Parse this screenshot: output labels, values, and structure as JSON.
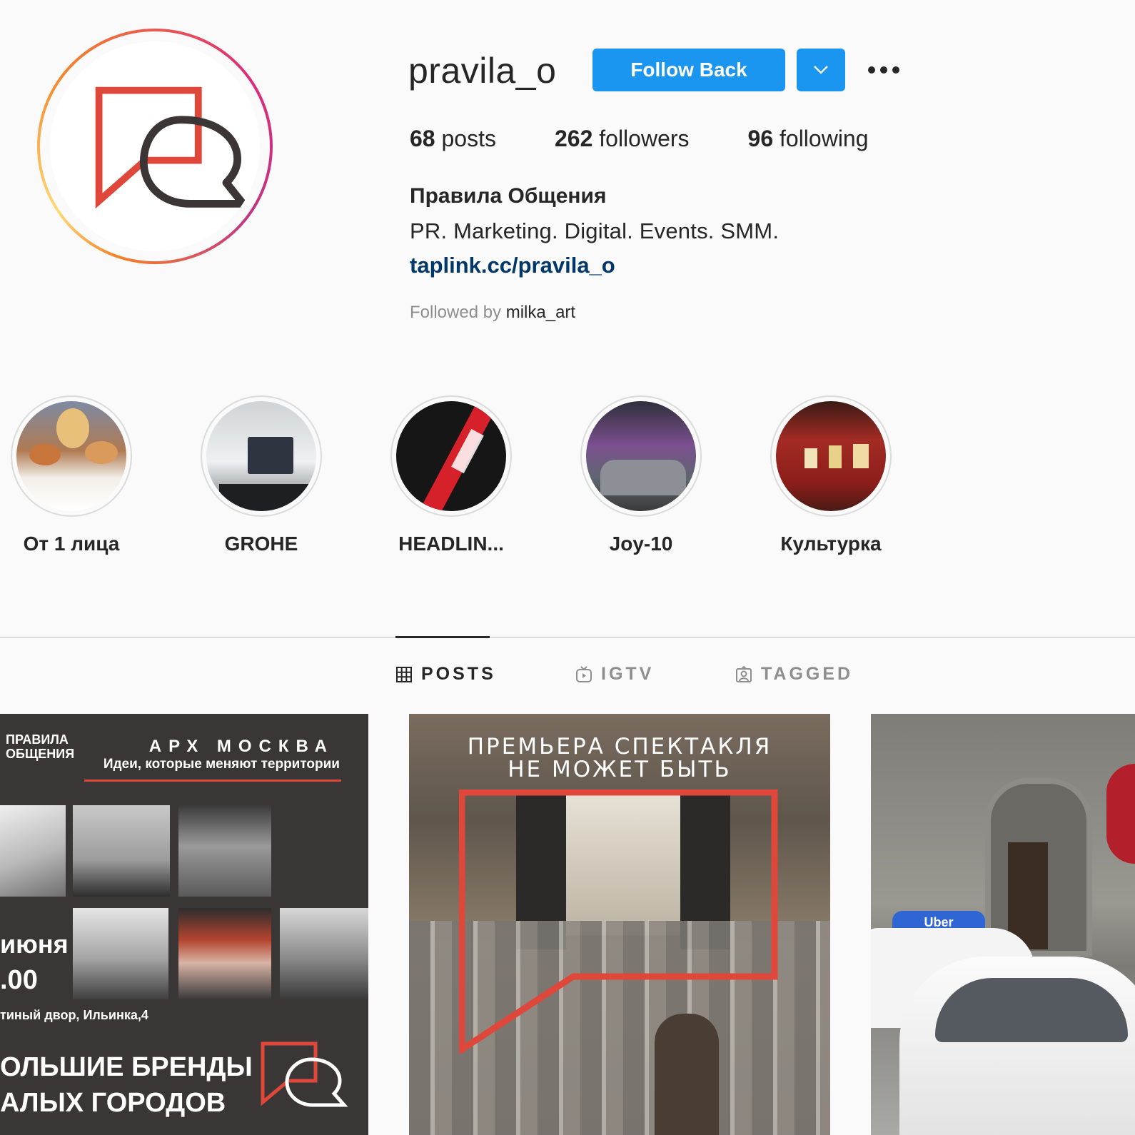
{
  "profile": {
    "username": "pravila_o",
    "follow_label": "Follow Back",
    "stats": {
      "posts_count": "68",
      "posts_label": "posts",
      "followers_count": "262",
      "followers_label": "followers",
      "following_count": "96",
      "following_label": "following"
    },
    "full_name": "Правила Общения",
    "bio": "PR. Marketing. Digital. Events. SMM.",
    "link": "taplink.cc/pravila_o",
    "followed_by_prefix": "Followed by",
    "followed_by_user": "milka_art"
  },
  "highlights": [
    {
      "label": "От 1 лица"
    },
    {
      "label": "GROHE"
    },
    {
      "label": "HEADLIN..."
    },
    {
      "label": "Joy-10"
    },
    {
      "label": "Культурка"
    }
  ],
  "tabs": [
    {
      "label": "POSTS",
      "active": true
    },
    {
      "label": "IGTV",
      "active": false
    },
    {
      "label": "TAGGED",
      "active": false
    }
  ],
  "posts": [
    {
      "logo_line1": "ПРАВИЛА",
      "logo_line2": "ОБЩЕНИЯ",
      "title": "АРХ МОСКВА",
      "subtitle": "Идеи, которые меняют территории",
      "date": "июня",
      "time": ".00",
      "place": "тиный двор, Ильинка,4",
      "brands_line1": "ОЛЬШИЕ БРЕНДЫ",
      "brands_line2": "АЛЫХ ГОРОДОВ"
    },
    {
      "title_line1": "ПРЕМЬЕРА СПЕКТАКЛЯ",
      "title_line2": "НЕ МОЖЕТ БЫТЬ"
    },
    {
      "sign": "Uber"
    }
  ],
  "colors": {
    "primary_button": "#1a95f0",
    "link": "#00376b",
    "brand_red": "#e0473b",
    "text": "#262626",
    "muted": "#8e8e8e"
  }
}
